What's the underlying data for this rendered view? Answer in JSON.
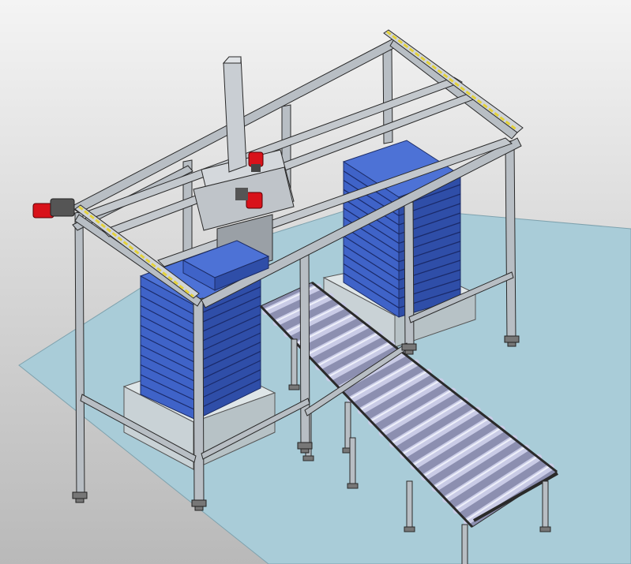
{
  "scene": {
    "subject": "gantry-palletizer-with-roller-conveyor",
    "background_color_top": "#f4f4f4",
    "background_color_bottom": "#b9b9b9",
    "floor_color": "#a9ccd8",
    "frame_color": "#b8bec4",
    "frame_edge_color": "#2a2a2a",
    "crate_color": "#3f63c8",
    "crate_dark_color": "#26408f",
    "motor_color": "#d8121a",
    "guide_stripe_color": "#e4d23a",
    "roller_color": "#c9cbe6",
    "base_block_color": "#d6dde0"
  }
}
